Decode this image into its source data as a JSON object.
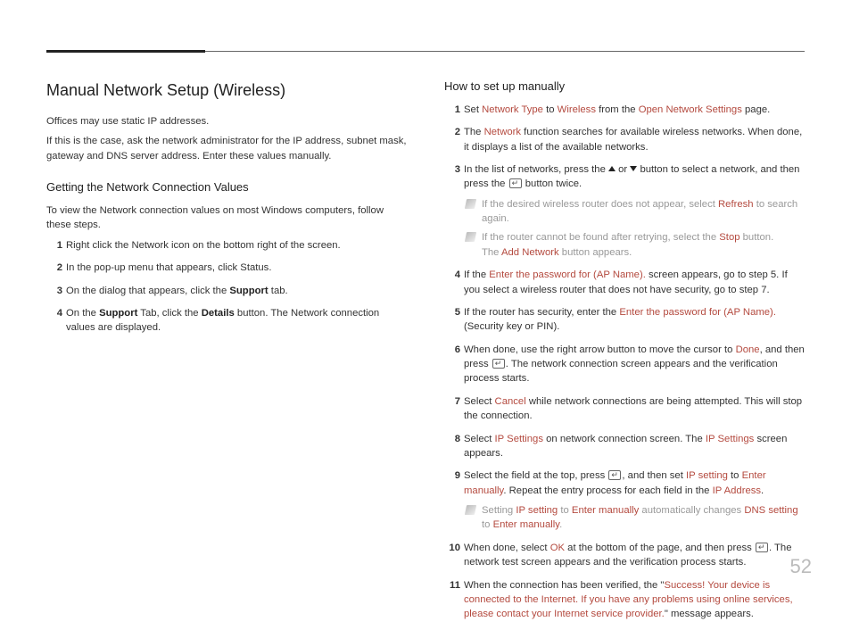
{
  "page_number": "52",
  "left": {
    "title": "Manual Network Setup (Wireless)",
    "para1": "Offices may use static IP addresses.",
    "para2": "If this is the case, ask the network administrator for the IP address, subnet mask, gateway and DNS server address. Enter these values manually.",
    "sub1": "Getting the Network Connection Values",
    "intro1": "To view the Network connection values on most Windows computers, follow these steps.",
    "s1": "Right click the Network icon on the bottom right of the screen.",
    "s2": "In the pop-up menu that appears, click Status.",
    "s3a": "On the dialog that appears, click the ",
    "s3b": "Support",
    "s3c": " tab.",
    "s4a": "On the ",
    "s4b": "Support",
    "s4c": " Tab, click the ",
    "s4d": "Details",
    "s4e": " button. The Network connection values are displayed."
  },
  "right": {
    "sub": "How to set up manually",
    "r1a": "Set ",
    "r1b": "Network Type",
    "r1c": " to ",
    "r1d": "Wireless",
    "r1e": " from the ",
    "r1f": "Open Network Settings",
    "r1g": " page.",
    "r2a": "The ",
    "r2b": "Network",
    "r2c": " function searches for available wireless networks. When done, it displays a list of the available networks.",
    "r3a": "In the list of networks, press the ",
    "r3b": " or ",
    "r3c": " button to select a network, and then press the ",
    "r3d": " button twice.",
    "n1a": "If the desired wireless router does not appear, select ",
    "n1b": "Refresh",
    "n1c": " to search again.",
    "n2a": "If the router cannot be found after retrying, select the ",
    "n2b": "Stop",
    "n2c": " button.",
    "n2d": "The ",
    "n2e": "Add Network",
    "n2f": " button appears.",
    "r4a": "If the ",
    "r4b": "Enter the password for (AP Name).",
    "r4c": " screen appears, go to step 5. If you select a wireless router that does not have security, go to step 7.",
    "r5a": "If the router has security, enter the ",
    "r5b": "Enter the password for (AP Name).",
    "r5c": " (Security key or PIN).",
    "r6a": "When done, use the right arrow button to move the cursor to ",
    "r6b": "Done",
    "r6c": ", and then press ",
    "r6d": ". The network connection screen appears and the verification process starts.",
    "r7a": "Select ",
    "r7b": "Cancel",
    "r7c": " while network connections are being attempted. This will stop the connection.",
    "r8a": "Select ",
    "r8b": "IP Settings",
    "r8c": " on network connection screen. The ",
    "r8d": "IP Settings",
    "r8e": " screen appears.",
    "r9a": "Select the field at the top, press ",
    "r9b": ", and then set ",
    "r9c": "IP setting",
    "r9d": " to ",
    "r9e": "Enter manually",
    "r9f": ". Repeat the entry process for each field in the ",
    "r9g": "IP Address",
    "r9h": ".",
    "n3a": "Setting ",
    "n3b": "IP setting",
    "n3c": " to ",
    "n3d": "Enter manually",
    "n3e": " automatically changes ",
    "n3f": "DNS setting",
    "n3g": " to ",
    "n3h": "Enter manually",
    "n3i": ".",
    "r10a": "When done, select ",
    "r10b": "OK",
    "r10c": " at the bottom of the page, and then press ",
    "r10d": ". The network test screen appears and the verification process starts.",
    "r11a": "When the connection has been verified, the \"",
    "r11b": "Success! Your device is connected to the Internet. If you have any problems using online services, please contact your Internet service provider.",
    "r11c": "\" message appears."
  }
}
